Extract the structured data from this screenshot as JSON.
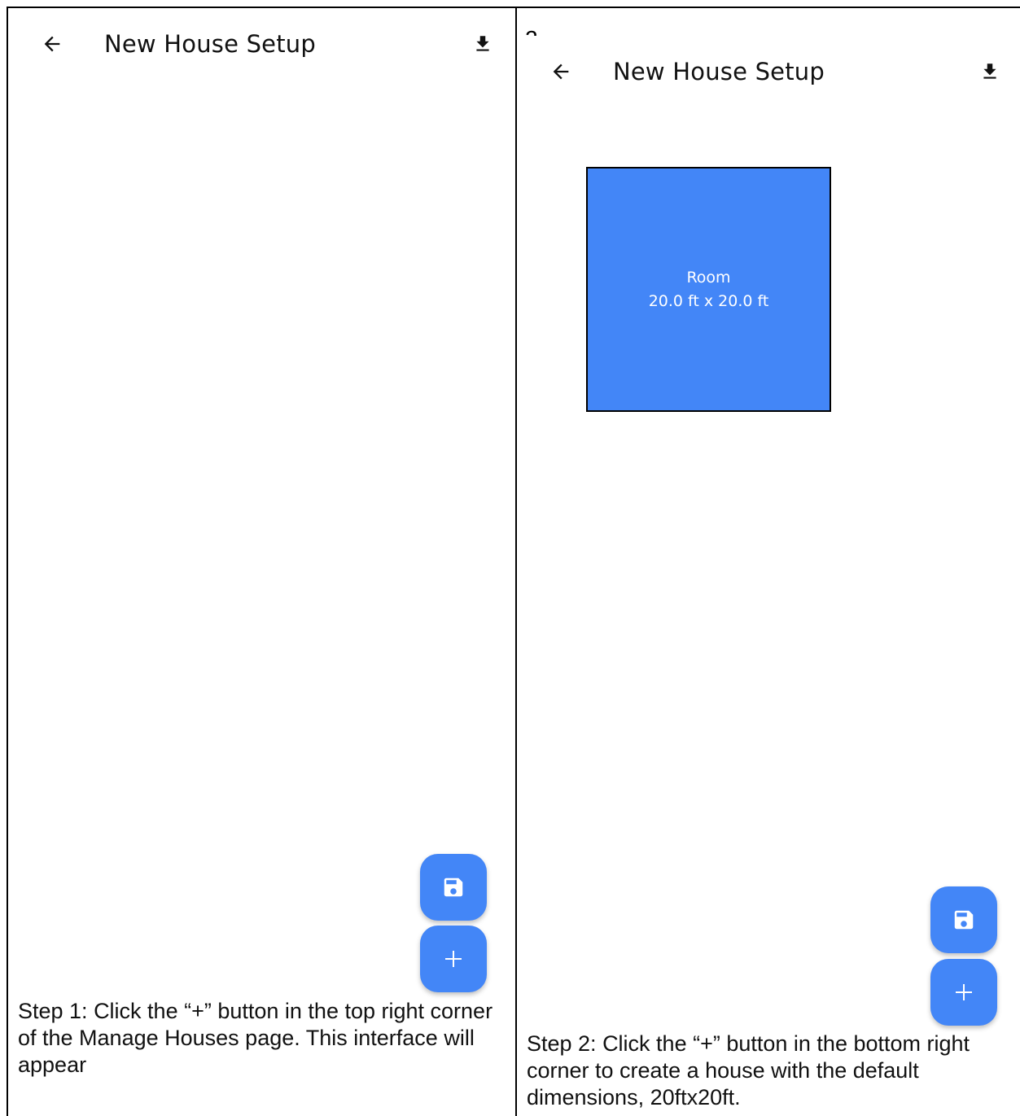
{
  "left_panel": {
    "app": {
      "title": "New House Setup",
      "back_icon": "arrow-left-icon",
      "download_icon": "download-icon"
    },
    "fab_save_icon": "floppy-disk-icon",
    "fab_add_label": "+",
    "caption": "Step 1: Click the “+” button in the top right corner of the Manage Houses page. This interface will appear"
  },
  "right_panel": {
    "step_number": "2.",
    "app": {
      "title": "New House Setup",
      "back_icon": "arrow-left-icon",
      "download_icon": "download-icon"
    },
    "room": {
      "name": "Room",
      "dimensions": "20.0 ft x 20.0 ft"
    },
    "fab_save_icon": "floppy-disk-icon",
    "fab_add_label": "+",
    "caption": "Step 2: Click the “+” button in the bottom right corner to create a house with the default dimensions, 20ftx20ft."
  },
  "colors": {
    "accent": "#4386f7",
    "border": "#000000",
    "background": "#ffffff"
  }
}
